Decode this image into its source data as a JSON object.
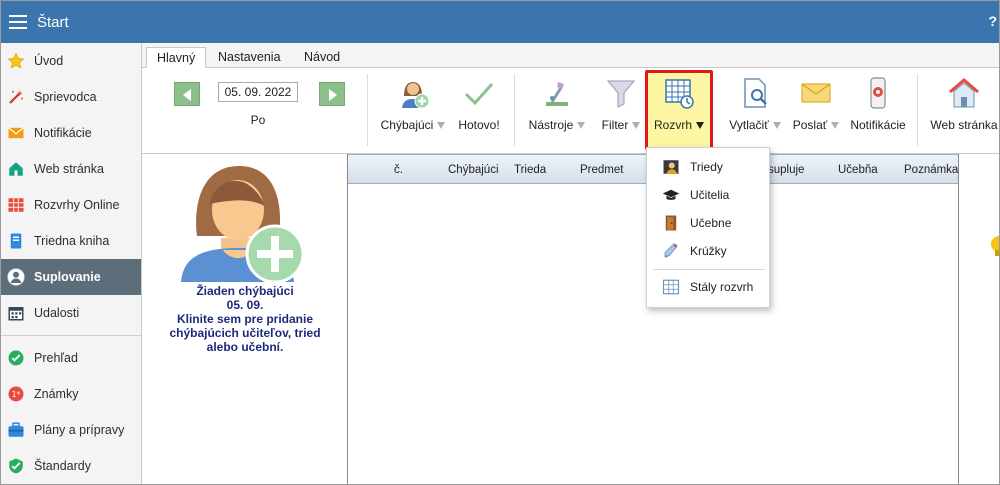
{
  "app": {
    "title": "Štart"
  },
  "sidebar": {
    "items": [
      {
        "label": "Úvod",
        "icon": "star-icon"
      },
      {
        "label": "Sprievodca",
        "icon": "wand-icon"
      },
      {
        "label": "Notifikácie",
        "icon": "envelope-icon"
      },
      {
        "label": "Web stránka",
        "icon": "home-icon"
      },
      {
        "label": "Rozvrhy Online",
        "icon": "timetable-icon"
      },
      {
        "label": "Triedna kniha",
        "icon": "book-icon"
      },
      {
        "label": "Suplovanie",
        "icon": "user-icon",
        "active": true
      },
      {
        "label": "Udalosti",
        "icon": "calendar-icon"
      },
      {
        "label": "Prehľad",
        "icon": "check-circle-icon"
      },
      {
        "label": "Známky",
        "icon": "grade-icon"
      },
      {
        "label": "Plány a prípravy",
        "icon": "briefcase-icon"
      },
      {
        "label": "Štandardy",
        "icon": "shield-check-icon"
      }
    ]
  },
  "tabs": [
    {
      "label": "Hlavný",
      "active": true
    },
    {
      "label": "Nastavenia"
    },
    {
      "label": "Návod"
    }
  ],
  "ribbon": {
    "date_value": "05. 09. 2022",
    "day": "Po",
    "buttons": {
      "chybajuci": "Chýbajúci",
      "hotovo": "Hotovo!",
      "nastroje": "Nástroje",
      "filter": "Filter",
      "rozvrh": "Rozvrh",
      "vytlacit": "Vytlačiť",
      "poslat": "Poslať",
      "notifikacie": "Notifikácie",
      "web": "Web stránka"
    }
  },
  "left_pane": {
    "line1": "Žiaden chýbajúci",
    "line2": "05. 09.",
    "line3": "Klinite sem pre pridanie",
    "line4": "chýbajúcich učiteľov, tried",
    "line5": "alebo učební."
  },
  "grid": {
    "columns": [
      "č.",
      "Chýbajúci",
      "Trieda",
      "Predmet",
      "supluje",
      "Učebňa",
      "Poznámka"
    ]
  },
  "dropdown": {
    "items": [
      {
        "label": "Triedy",
        "icon": "class-icon"
      },
      {
        "label": "Učitelia",
        "icon": "graduation-cap-icon"
      },
      {
        "label": "Učebne",
        "icon": "door-icon"
      },
      {
        "label": "Krúžky",
        "icon": "club-icon"
      }
    ],
    "footer_item": {
      "label": "Stály rozvrh",
      "icon": "grid-icon"
    }
  },
  "colors": {
    "titlebar": "#3a76ad",
    "active_sidebar": "#5b6e7a",
    "highlight_fill": "#fdf7a4",
    "highlight_border": "#e01818",
    "text_blue": "#1d2a7a"
  }
}
